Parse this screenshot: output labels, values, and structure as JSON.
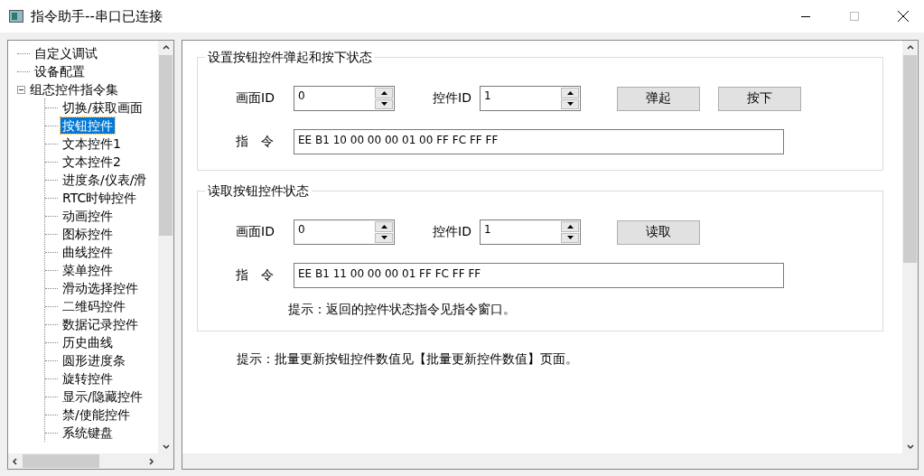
{
  "window": {
    "title": "指令助手--串口已连接"
  },
  "tree": {
    "items": [
      {
        "label": "自定义调试",
        "selected": false
      },
      {
        "label": "设备配置",
        "selected": false
      },
      {
        "label": "组态控件指令集",
        "selected": false,
        "expanded": true,
        "children": [
          {
            "label": "切换/获取画面",
            "selected": false
          },
          {
            "label": "按钮控件",
            "selected": true
          },
          {
            "label": "文本控件1",
            "selected": false
          },
          {
            "label": "文本控件2",
            "selected": false
          },
          {
            "label": "进度条/仪表/滑",
            "selected": false
          },
          {
            "label": "RTC时钟控件",
            "selected": false
          },
          {
            "label": "动画控件",
            "selected": false
          },
          {
            "label": "图标控件",
            "selected": false
          },
          {
            "label": "曲线控件",
            "selected": false
          },
          {
            "label": "菜单控件",
            "selected": false
          },
          {
            "label": "滑动选择控件",
            "selected": false
          },
          {
            "label": "二维码控件",
            "selected": false
          },
          {
            "label": "数据记录控件",
            "selected": false
          },
          {
            "label": "历史曲线",
            "selected": false
          },
          {
            "label": "圆形进度条",
            "selected": false
          },
          {
            "label": "旋转控件",
            "selected": false
          },
          {
            "label": "显示/隐藏控件",
            "selected": false
          },
          {
            "label": "禁/使能控件",
            "selected": false
          },
          {
            "label": "系统键盘",
            "selected": false
          }
        ]
      }
    ]
  },
  "groups": [
    {
      "title": "设置按钮控件弹起和按下状态",
      "fields": [
        {
          "label": "画面ID",
          "value": "0"
        },
        {
          "label": "控件ID",
          "value": "1"
        }
      ],
      "buttons": [
        "弹起",
        "按下"
      ],
      "command": {
        "label": "指　令",
        "value": "EE B1 10 00 00 00 01 00 FF FC FF FF"
      }
    },
    {
      "title": "读取按钮控件状态",
      "fields": [
        {
          "label": "画面ID",
          "value": "0"
        },
        {
          "label": "控件ID",
          "value": "1"
        }
      ],
      "buttons": [
        "读取"
      ],
      "command": {
        "label": "指　令",
        "value": "EE B1 11 00 00 00 01 FF FC FF FF"
      },
      "hint": "提示：返回的控件状态指令见指令窗口。"
    }
  ],
  "footer_hint": "提示：批量更新按钮控件数值见【批量更新控件数值】页面。"
}
